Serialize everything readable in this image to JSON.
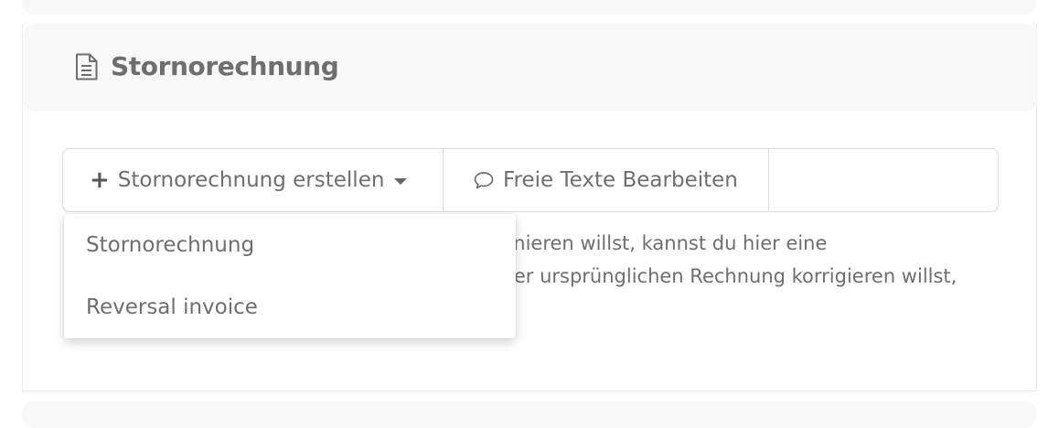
{
  "section": {
    "title": "Stornorechnung",
    "icon": "document-icon"
  },
  "toolbar": {
    "create_label": "Stornorechnung erstellen",
    "texts_label": "Freie Texte Bearbeiten"
  },
  "dropdown": {
    "items": [
      "Stornorechnung",
      "Reversal invoice"
    ]
  },
  "description": {
    "line1": "rnieren willst, kannst du hier eine",
    "line2": "ler ursprünglichen Rechnung korrigieren willst,"
  }
}
